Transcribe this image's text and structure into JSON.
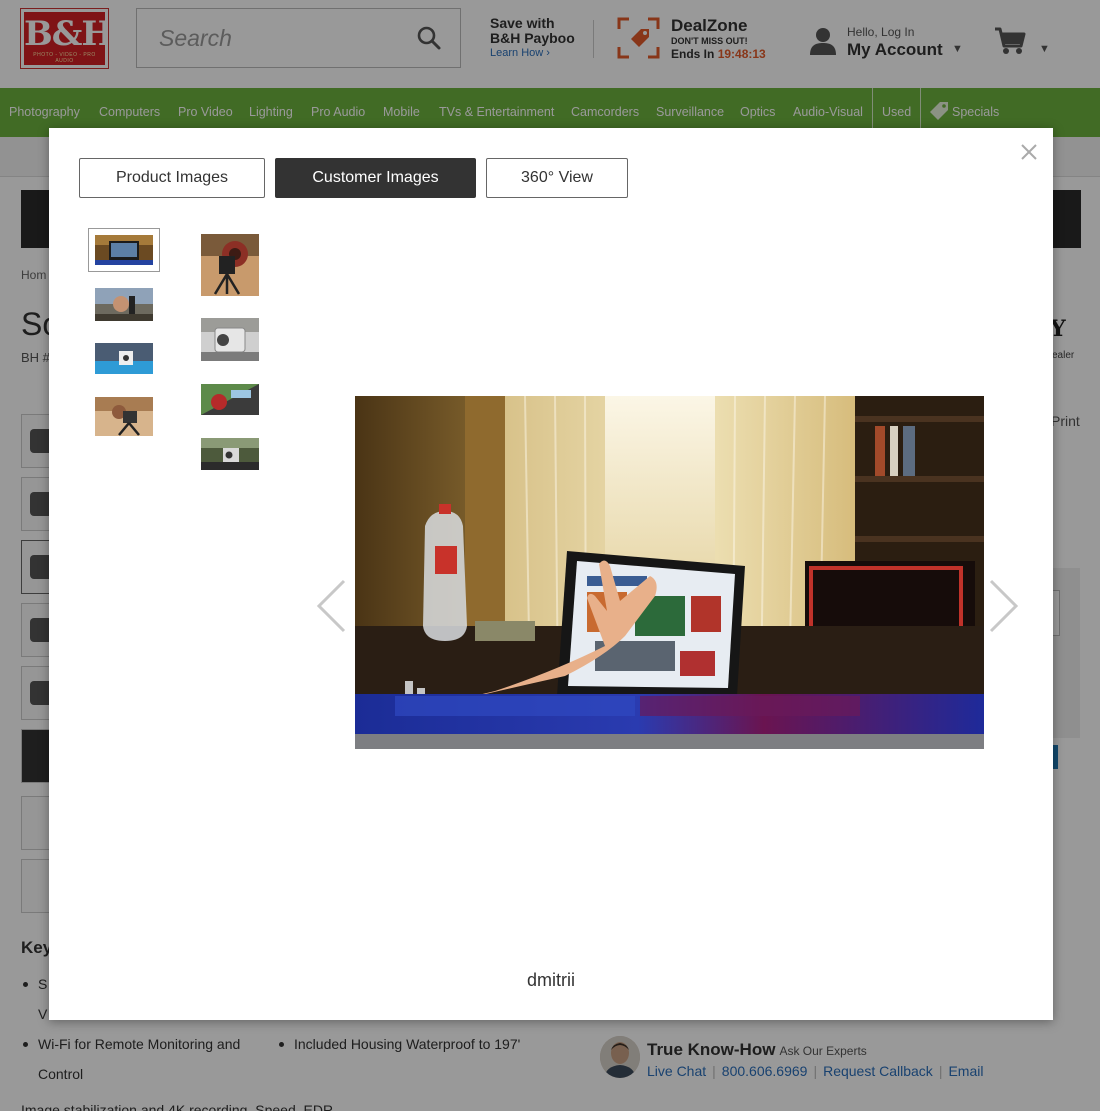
{
  "header": {
    "logo_text": "B&H",
    "logo_tagline": "PHOTO - VIDEO - PRO AUDIO",
    "search_placeholder": "Search",
    "payboo_line1": "Save with",
    "payboo_line2": "B&H Payboo",
    "payboo_link": "Learn How ›",
    "dealzone_title": "DealZone",
    "dealzone_sub": "DON'T MISS OUT!",
    "dealzone_ends_label": "Ends In",
    "dealzone_timer": "19:48:13",
    "account_hello": "Hello, Log In",
    "account_label": "My Account"
  },
  "nav": {
    "items": [
      "Photography",
      "Computers",
      "Pro Video",
      "Lighting",
      "Pro Audio",
      "Mobile",
      "TVs & Entertainment",
      "Camcorders",
      "Surveillance",
      "Optics",
      "Audio-Visual",
      "Used",
      "Specials"
    ]
  },
  "page": {
    "breadcrumb": "Hom",
    "title_fragment": "So",
    "bh_fragment": "BH #",
    "brand_fragment": "Y",
    "dealer_fragment": "ealer",
    "print_label": "Print",
    "key_features_fragment": "Key",
    "bullets": [
      "S",
      "V",
      "Wi-Fi for Remote Monitoring and",
      "Control",
      "Included Housing Waterproof to 197'"
    ],
    "bottom_text": "Image stabilization and 4K recording, Speed, EDR"
  },
  "expert": {
    "title": "True Know-How",
    "subtitle": "Ask Our Experts",
    "live_chat": "Live Chat",
    "phone": "800.606.6969",
    "callback": "Request Callback",
    "email": "Email"
  },
  "modal": {
    "tabs": [
      {
        "label": "Product Images",
        "active": false
      },
      {
        "label": "Customer Images",
        "active": true
      },
      {
        "label": "360° View",
        "active": false
      }
    ],
    "caption": "dmitrii",
    "selected_thumbnail": 1,
    "thumbnail_count": 8
  },
  "colors": {
    "nav_green": "#6db33f",
    "brand_red": "#d42026",
    "timer_orange": "#e35b2a",
    "link_blue": "#2a6ebb",
    "active_tab": "#333333"
  }
}
